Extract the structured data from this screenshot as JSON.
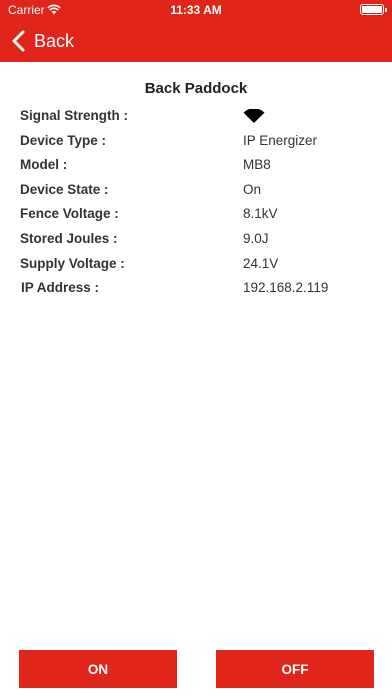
{
  "status_bar": {
    "carrier": "Carrier",
    "time": "11:33 AM"
  },
  "nav": {
    "back_label": "Back"
  },
  "device": {
    "name": "Back Paddock",
    "rows": [
      {
        "label": "Signal Strength :",
        "value": "",
        "icon": "wifi-signal-icon"
      },
      {
        "label": "Device Type :",
        "value": "IP Energizer"
      },
      {
        "label": "Model :",
        "value": "MB8"
      },
      {
        "label": "Device State :",
        "value": "On"
      },
      {
        "label": "Fence Voltage :",
        "value": "8.1kV"
      },
      {
        "label": "Stored Joules :",
        "value": "9.0J"
      },
      {
        "label": "Supply Voltage :",
        "value": "24.1V"
      },
      {
        "label": "IP Address :",
        "value": "192.168.2.119"
      }
    ]
  },
  "actions": {
    "on_label": "ON",
    "off_label": "OFF"
  },
  "colors": {
    "accent": "#e0251b",
    "text": "#333333",
    "background": "#ffffff"
  }
}
